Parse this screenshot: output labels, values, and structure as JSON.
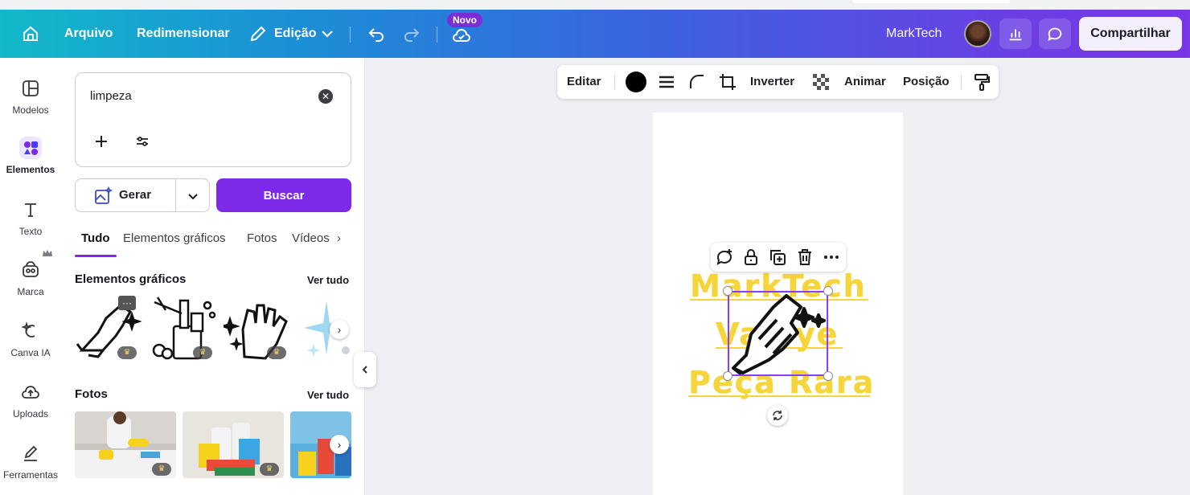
{
  "header": {
    "arquivo": "Arquivo",
    "redimensionar": "Redimensionar",
    "edicao": "Edição",
    "novo_badge": "Novo",
    "team_name": "MarkTech",
    "share": "Compartilhar"
  },
  "rail": [
    {
      "label": "Modelos"
    },
    {
      "label": "Elementos"
    },
    {
      "label": "Texto"
    },
    {
      "label": "Marca"
    },
    {
      "label": "Canva IA"
    },
    {
      "label": "Uploads"
    },
    {
      "label": "Ferramentas"
    }
  ],
  "search": {
    "value": "limpeza"
  },
  "gerar_label": "Gerar",
  "buscar_label": "Buscar",
  "tabs": [
    "Tudo",
    "Elementos gráficos",
    "Fotos",
    "Vídeos"
  ],
  "sections": {
    "graphics_title": "Elementos gráficos",
    "photos_title": "Fotos",
    "see_all": "Ver tudo"
  },
  "toolbar": {
    "editar": "Editar",
    "inverter": "Inverter",
    "animar": "Animar",
    "posicao": "Posição",
    "color": "#000000"
  },
  "canvas": {
    "line1": "MarkTech",
    "line2": "Valvye",
    "line3": "Peça Rara",
    "text_color": "#f5d53a"
  },
  "colors": {
    "accent": "#7d2ae8"
  }
}
